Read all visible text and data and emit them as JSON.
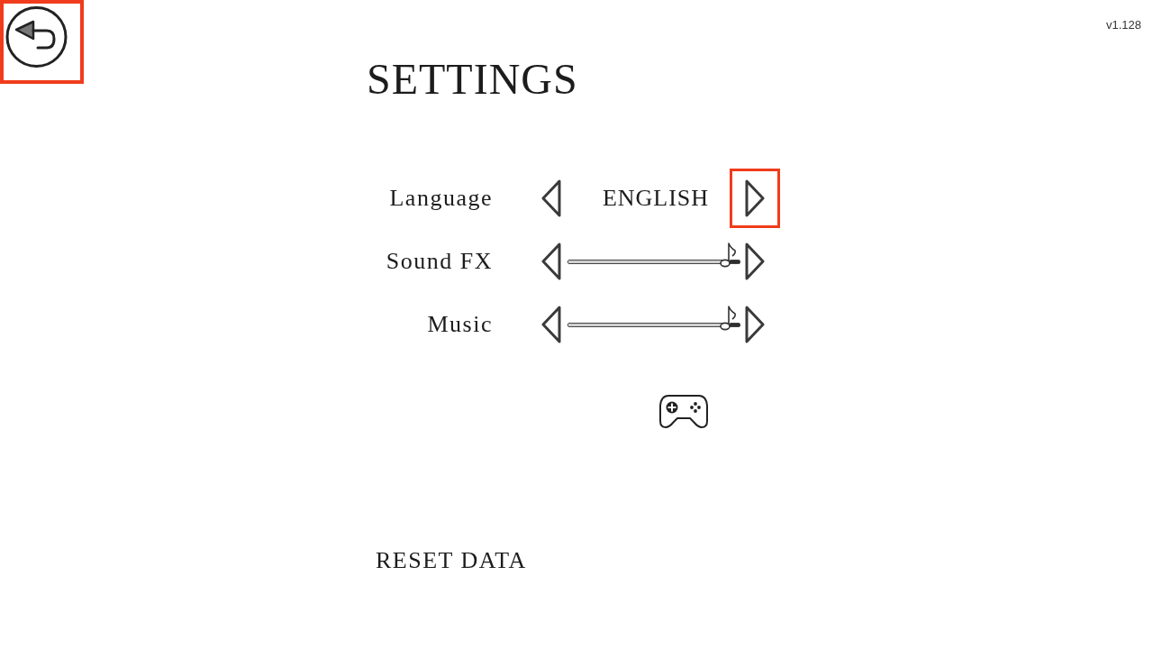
{
  "back_button": {
    "focused": true
  },
  "version": "v1.128",
  "title": "SETTINGS",
  "settings": [
    {
      "kind": "choice",
      "label": "Language",
      "value": "ENGLISH",
      "prev_focused": false,
      "next_focused": true
    },
    {
      "kind": "slider",
      "label": "Sound FX",
      "level": 0.94,
      "prev_focused": false,
      "next_focused": false
    },
    {
      "kind": "slider",
      "label": "Music",
      "level": 0.94,
      "prev_focused": false,
      "next_focused": false
    }
  ],
  "reset_button": {
    "label": "RESET DATA"
  }
}
